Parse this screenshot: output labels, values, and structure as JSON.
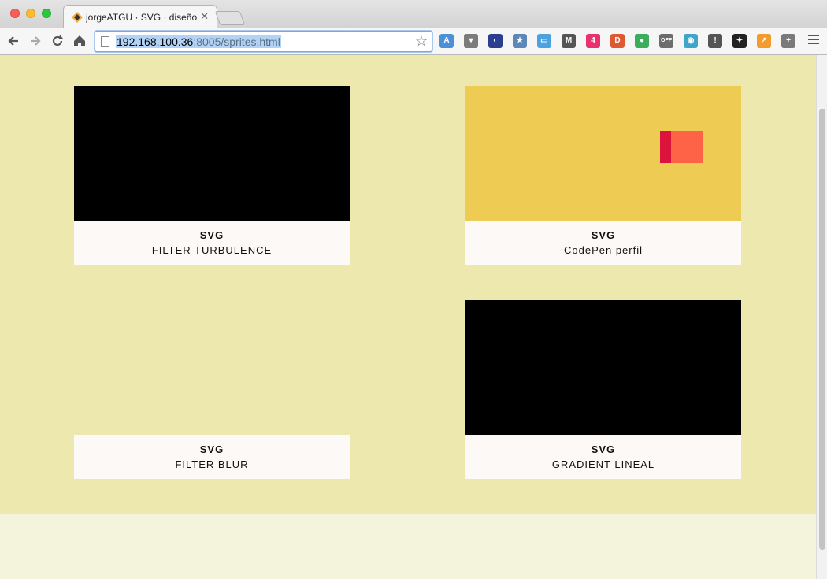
{
  "browser": {
    "tab_title": "jorgeATGU · SVG · diseño c",
    "tab_close": "✕",
    "url_host": "192.168.100.36",
    "url_rest": ":8005/sprites.html",
    "back_icon": "arrow-left-icon",
    "forward_icon": "arrow-right-icon",
    "reload_icon": "reload-icon",
    "home_icon": "home-icon",
    "bookmark_icon": "star-icon",
    "extensions": [
      {
        "name": "translate-icon",
        "color": "#4a90d9",
        "label": "A"
      },
      {
        "name": "pocket-icon",
        "color": "#7b7b7b",
        "label": "▾"
      },
      {
        "name": "speed-icon",
        "color": "#2c3e8f",
        "label": "◐"
      },
      {
        "name": "bookmark-star-icon",
        "color": "#5d87b8",
        "label": "★"
      },
      {
        "name": "window-icon",
        "color": "#4aa3df",
        "label": "▭"
      },
      {
        "name": "m-icon",
        "color": "#555555",
        "label": "M"
      },
      {
        "name": "stairs-icon",
        "color": "#e8326e",
        "label": "4"
      },
      {
        "name": "duckduckgo-icon",
        "color": "#de5833",
        "label": "D"
      },
      {
        "name": "leaf-icon",
        "color": "#3cae5b",
        "label": "●"
      },
      {
        "name": "off-icon",
        "color": "#6d6d6d",
        "label": "OFF"
      },
      {
        "name": "robot-icon",
        "color": "#3fa5c9",
        "label": "◉"
      },
      {
        "name": "info-icon",
        "color": "#555555",
        "label": "!"
      },
      {
        "name": "ninja-icon",
        "color": "#222222",
        "label": "✦"
      },
      {
        "name": "chart-icon",
        "color": "#f39c2d",
        "label": "↗"
      },
      {
        "name": "crosshair-icon",
        "color": "#7a7a7a",
        "label": "+"
      }
    ]
  },
  "cards": [
    {
      "title": "SVG",
      "subtitle": "FILTER TURBULENCE"
    },
    {
      "title": "SVG",
      "subtitle": "CodePen perfil"
    },
    {
      "title": "SVG",
      "subtitle": "FILTER BLUR"
    },
    {
      "title": "SVG",
      "subtitle": "GRADIENT LINEAL"
    }
  ],
  "colors": {
    "hero_bg": "#ede8ad",
    "card_caption_bg": "#fcf9f7",
    "codepen_bg": "#eecb52",
    "codepen_red": "#dc143c",
    "codepen_orange": "#ff6347"
  }
}
